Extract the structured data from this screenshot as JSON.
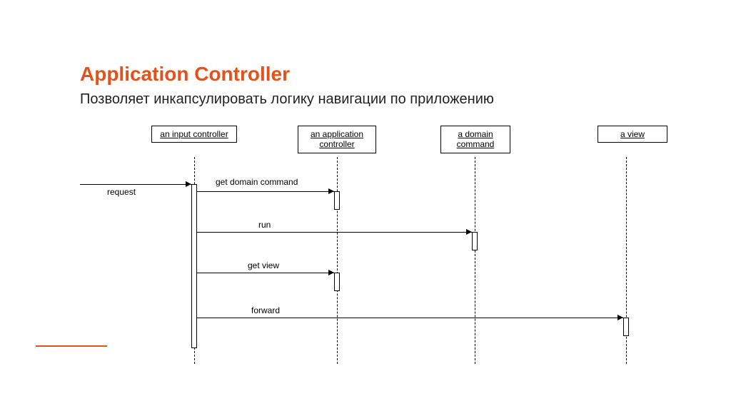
{
  "title": "Application Controller",
  "subtitle": "Позволяет инкапсулировать логику навигации по приложению",
  "participants": {
    "input_controller": "an input controller",
    "app_controller_l1": "an application",
    "app_controller_l2": "controller",
    "domain_command_l1": "a domain",
    "domain_command_l2": "command",
    "view": "a view"
  },
  "messages": {
    "request": "request",
    "m1": "get domain command",
    "m2": "run",
    "m3": "get view",
    "m4": "forward"
  }
}
